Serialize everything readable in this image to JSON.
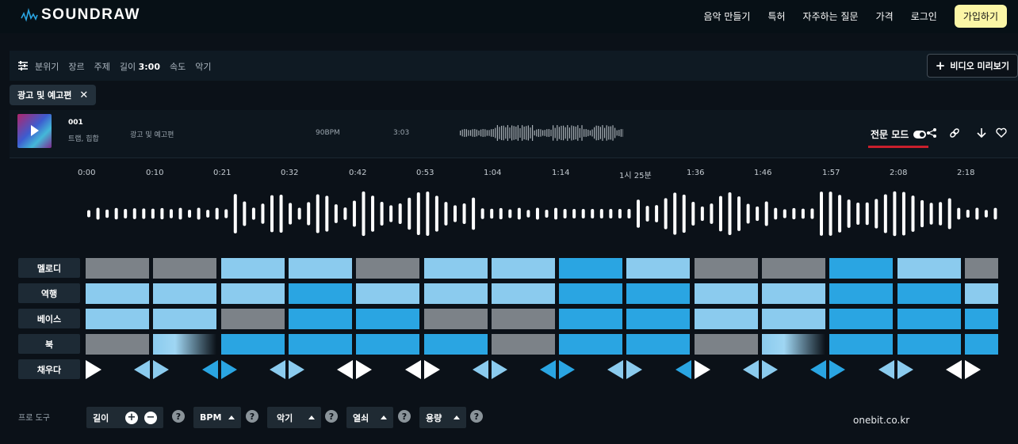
{
  "brand": {
    "name": "SOUNDRAW"
  },
  "nav": {
    "items": [
      "음악 만들기",
      "특허",
      "자주하는 질문",
      "가격",
      "로그인"
    ],
    "signup_label": "가입하기"
  },
  "filters": {
    "items": [
      "분위기",
      "장르",
      "주제"
    ],
    "length_label": "길이",
    "length_value": "3:00",
    "tail_items": [
      "속도",
      "악기"
    ],
    "video_preview_label": "비디오 미리보기"
  },
  "active_tag": {
    "label": "광고 및 예고편"
  },
  "track": {
    "number": "001",
    "genre": "트랩, 힙합",
    "mood": "광고 및 예고편",
    "bpm": "90BPM",
    "length": "3:03",
    "pro_mode_label": "전문 모드"
  },
  "timeline": {
    "times": [
      "0:00",
      "0:10",
      "0:21",
      "0:32",
      "0:42",
      "0:53",
      "1:04",
      "1:14",
      "1시 25분",
      "1:36",
      "1:46",
      "1:57",
      "2:08",
      "2:18"
    ]
  },
  "rows": [
    {
      "label": "멜로디",
      "cells": [
        "g",
        "g",
        "l",
        "l",
        "g",
        "l",
        "l",
        "d",
        "l",
        "g",
        "g",
        "d",
        "l",
        "g"
      ]
    },
    {
      "label": "역행",
      "cells": [
        "l",
        "l",
        "l",
        "d",
        "l",
        "l",
        "l",
        "d",
        "d",
        "l",
        "l",
        "d",
        "d",
        "l"
      ]
    },
    {
      "label": "베이스",
      "cells": [
        "l",
        "l",
        "g",
        "d",
        "d",
        "g",
        "g",
        "d",
        "d",
        "l",
        "l",
        "d",
        "d",
        "d"
      ]
    },
    {
      "label": "북",
      "cells": [
        "g",
        "f",
        "d",
        "d",
        "d",
        "d",
        "g",
        "d",
        "d",
        "g",
        "f",
        "d",
        "d",
        "d"
      ]
    }
  ],
  "fill_row": {
    "label": "채우다",
    "cells": [
      [
        "",
        "w"
      ],
      [
        "l",
        "l"
      ],
      [
        "d",
        "d"
      ],
      [
        "l",
        "l"
      ],
      [
        "w",
        "w"
      ],
      [
        "w",
        "w"
      ],
      [
        "l",
        "l"
      ],
      [
        "d",
        "d"
      ],
      [
        "l",
        "l"
      ],
      [
        "d",
        "w"
      ],
      [
        "l",
        "l"
      ],
      [
        "d",
        "d"
      ],
      [
        "l",
        "l"
      ],
      [
        "w",
        "w"
      ]
    ]
  },
  "pro_tools": {
    "label": "프로 도구",
    "length_label": "길이",
    "bpm_label": "BPM",
    "instrument_label": "악기",
    "key_label": "열쇠",
    "volume_label": "용량"
  },
  "watermark": "onebit.co.kr",
  "colors": {
    "gray_block": "#7c8288",
    "light_block": "#8bcbee",
    "dark_block": "#2aa5e2",
    "signup_bg": "#fbf6a6",
    "pro_underline": "#c91f2c"
  }
}
